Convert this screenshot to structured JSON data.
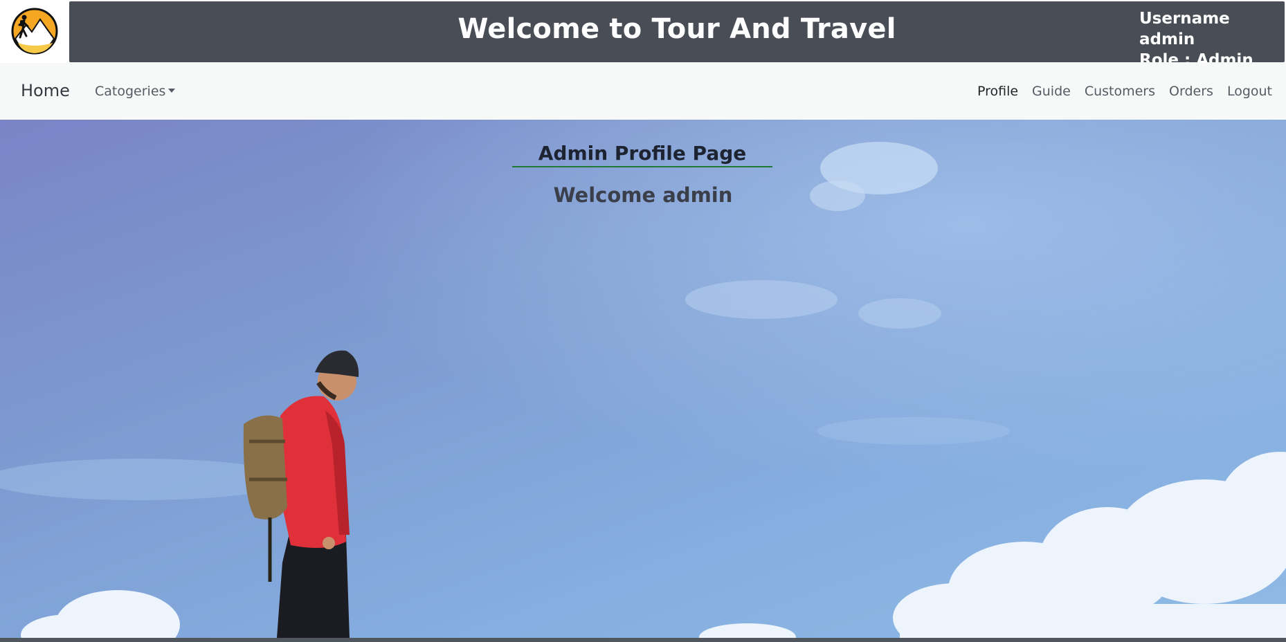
{
  "header": {
    "title": "Welcome to Tour And Travel",
    "username_line": "Username admin",
    "role_line": "Role : Admin",
    "logo_icon": "hiker-mountain-logo-icon"
  },
  "nav": {
    "home": "Home",
    "categories": "Catogeries",
    "right_links": [
      "Profile",
      "Guide",
      "Customers",
      "Orders",
      "Logout"
    ],
    "active": "Profile"
  },
  "main": {
    "heading": "Admin Profile Page",
    "welcome": "Welcome admin"
  },
  "colors": {
    "header_band": "#494d55",
    "navbar_bg": "#f7f9f8",
    "heading_underline": "#1e7a34",
    "sky": "#86aee0",
    "jacket": "#e0303a"
  }
}
